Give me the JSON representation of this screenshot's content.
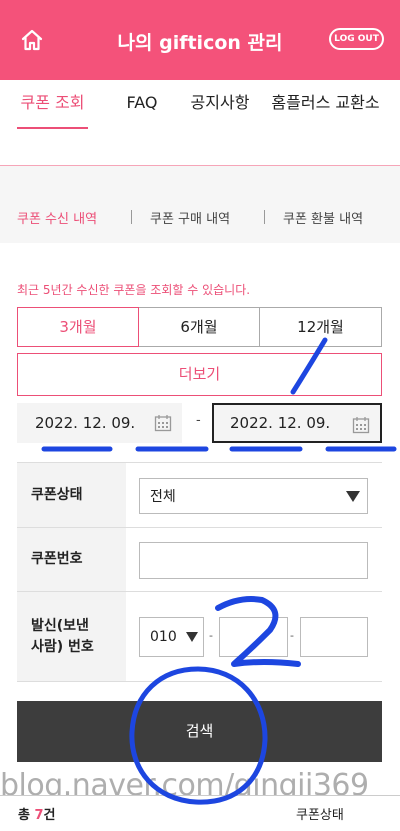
{
  "header": {
    "title": "나의 gifticon 관리",
    "logout_label": "LOG OUT"
  },
  "tabs": [
    {
      "label": "쿠폰 조회",
      "active": true
    },
    {
      "label": "FAQ"
    },
    {
      "label": "공지사항"
    },
    {
      "label": "홈플러스 교환소"
    }
  ],
  "subtabs": [
    {
      "label": "쿠폰 수신 내역",
      "active": true
    },
    {
      "label": "쿠폰 구매 내역"
    },
    {
      "label": "쿠폰 환불 내역"
    }
  ],
  "notice": "최근 5년간 수신한 쿠폰을 조회할 수 있습니다.",
  "periods": [
    "3개월",
    "6개월",
    "12개월"
  ],
  "more_label": "더보기",
  "date_range": {
    "start": "2022. 12. 09.",
    "separator": "-",
    "end": "2022. 12. 09."
  },
  "form": {
    "status_label": "쿠폰상태",
    "status_value": "전체",
    "number_label": "쿠폰번호",
    "number_value": "",
    "sender_label_line1": "발신(보낸",
    "sender_label_line2": "사람) 번호",
    "phone_prefix": "010",
    "phone_sep": "-"
  },
  "search_label": "검색",
  "watermark": "blog.naver.com/qingji369",
  "footer": {
    "total_prefix": "총 ",
    "total_count": "7",
    "total_suffix": "건",
    "column_label": "쿠폰상태"
  },
  "colors": {
    "brand": "#f4527a",
    "accent_text": "#ec4f77",
    "annotation_ink": "#1d46e0"
  },
  "icons": [
    "home-icon",
    "calendar-icon",
    "dropdown-arrow-icon"
  ]
}
